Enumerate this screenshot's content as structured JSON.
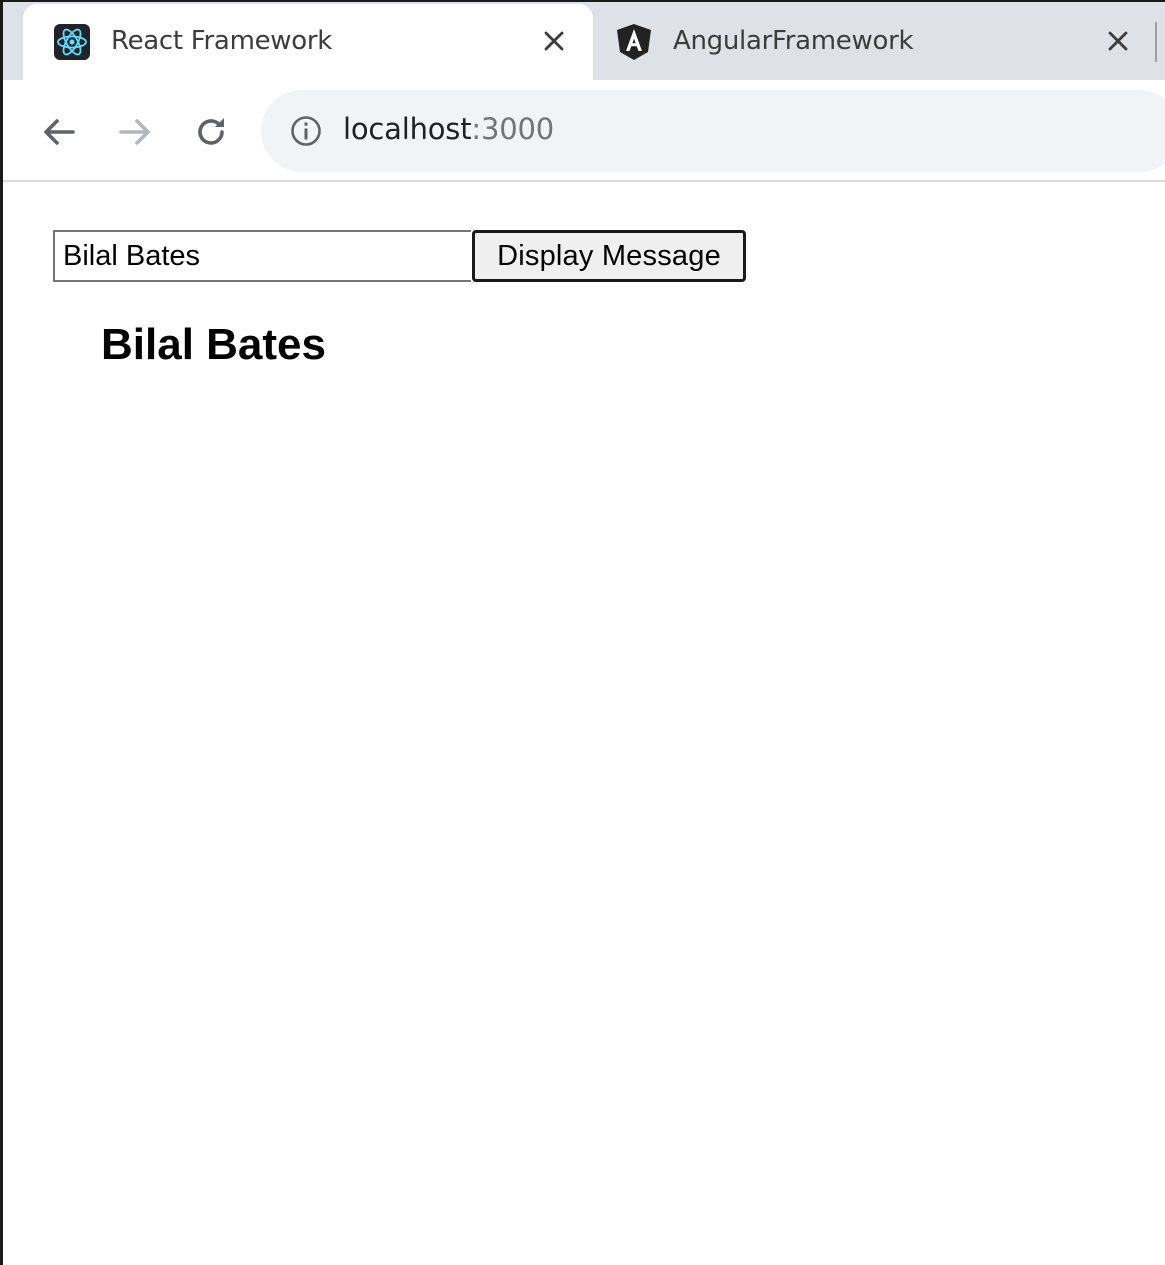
{
  "browser": {
    "tabs": [
      {
        "title": "React Framework",
        "icon": "react-logo-icon",
        "active": true
      },
      {
        "title": "AngularFramework",
        "icon": "angular-logo-icon",
        "active": false
      }
    ],
    "close_icon": "close-icon",
    "toolbar": {
      "back_icon": "arrow-left-icon",
      "forward_icon": "arrow-right-icon",
      "reload_icon": "reload-icon",
      "info_icon": "info-icon",
      "url_host": "localhost",
      "url_port": ":3000"
    }
  },
  "page": {
    "input_value": "Bilal Bates",
    "button_label": "Display Message",
    "message": "Bilal Bates"
  },
  "colors": {
    "tabstrip_bg": "#dee1e6",
    "omnibox_bg": "#f1f3f4",
    "react_blue": "#61dafb",
    "angular_shield": "#222222"
  }
}
